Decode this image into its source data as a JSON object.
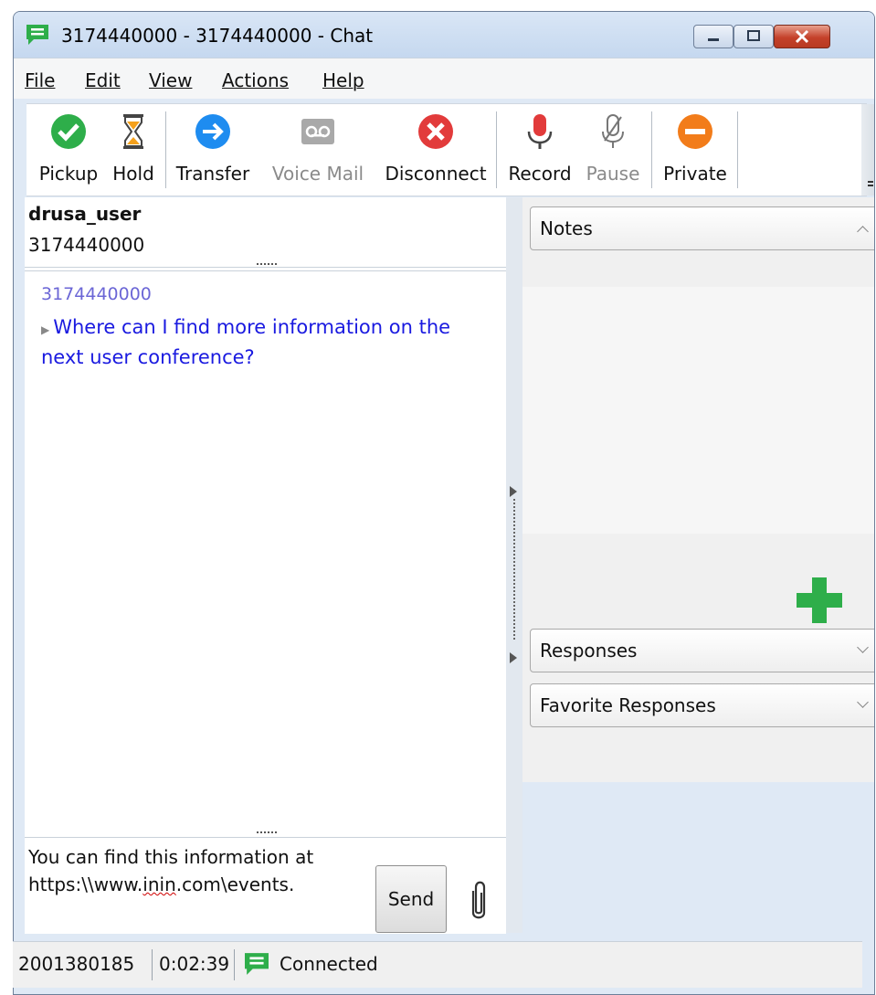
{
  "window": {
    "title": "3174440000 - 3174440000 - Chat"
  },
  "menu": [
    "File",
    "Edit",
    "View",
    "Actions",
    "Help"
  ],
  "toolbar": {
    "pickup": "Pickup",
    "hold": "Hold",
    "transfer": "Transfer",
    "voicemail": "Voice Mail",
    "disconnect": "Disconnect",
    "record": "Record",
    "pause": "Pause",
    "private": "Private"
  },
  "contact": {
    "name": "drusa_user",
    "number": "3174440000"
  },
  "transcript": {
    "sender": "3174440000",
    "message": "Where can I find more information on the next user conference?"
  },
  "compose": {
    "line1": "You can find this information at",
    "line2_a": "https:\\\\www.",
    "line2_b": "inin",
    "line2_c": ".com\\events.",
    "send": "Send"
  },
  "panels": {
    "notes": "Notes",
    "responses": "Responses",
    "favorites": "Favorite Responses"
  },
  "status": {
    "id": "2001380185",
    "time": "0:02:39",
    "state": "Connected"
  },
  "colors": {
    "accent_green": "#2eae4a",
    "disconnect_red": "#e23b3b",
    "transfer_blue": "#1e8cf0",
    "private_orange": "#f27c1a",
    "message_blue": "#1a1ae0"
  }
}
